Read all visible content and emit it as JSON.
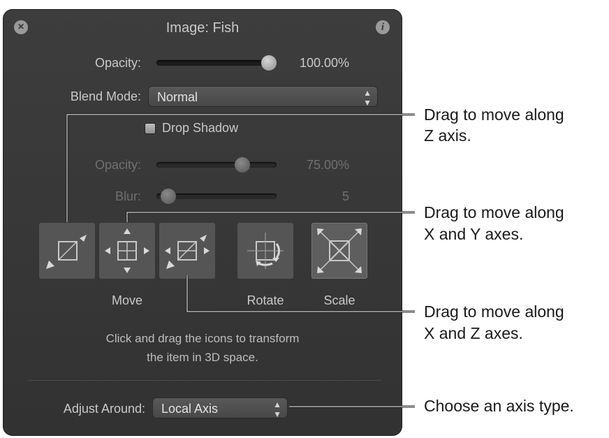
{
  "panel": {
    "title": "Image: Fish",
    "close_icon": "close-icon",
    "info_icon": "info-icon",
    "info_glyph": "i"
  },
  "opacity": {
    "label": "Opacity:",
    "value": "100.00%",
    "level": 1.0
  },
  "blend_mode": {
    "label": "Blend Mode:",
    "value": "Normal"
  },
  "drop_shadow": {
    "label": "Drop Shadow",
    "checked": false,
    "opacity": {
      "label": "Opacity:",
      "value": "75.00%",
      "level": 0.75
    },
    "blur": {
      "label": "Blur:",
      "value": "5",
      "level": 0.05
    }
  },
  "transform_tools": {
    "move_z_icon": "move-z-icon",
    "move_xy_icon": "move-xy-icon",
    "move_xz_icon": "move-xz-icon",
    "rotate_icon": "rotate-icon",
    "scale_icon": "scale-icon",
    "move_caption": "Move",
    "rotate_caption": "Rotate",
    "scale_caption": "Scale"
  },
  "help_text": {
    "line1": "Click and drag the icons to transform",
    "line2": "the item in 3D space."
  },
  "adjust_around": {
    "label": "Adjust Around:",
    "value": "Local Axis"
  },
  "callouts": {
    "z_line1": "Drag to move along",
    "z_line2": "Z axis.",
    "xy_line1": "Drag to move along",
    "xy_line2": "X and Y axes.",
    "xz_line1": "Drag to move along",
    "xz_line2": "X and Z axes.",
    "axis_type": "Choose an axis type."
  },
  "colors": {
    "panel_bg": "#383838",
    "text": "#c9c9c9",
    "dim_text": "#707070",
    "callout_text": "#1a1a1a"
  }
}
